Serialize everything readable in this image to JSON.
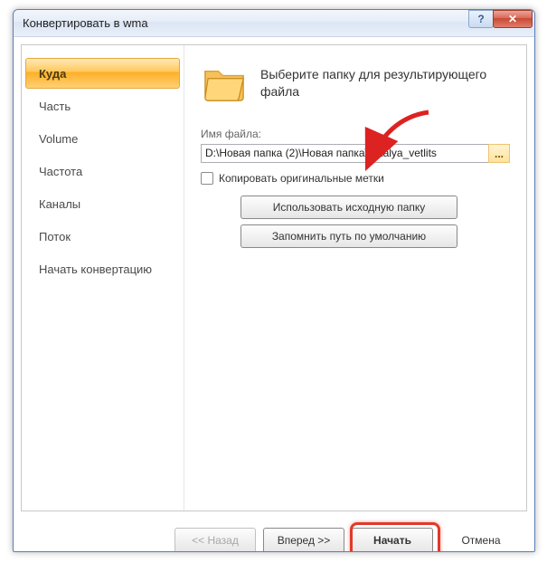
{
  "window": {
    "title": "Конвертировать в wma"
  },
  "sidebar": {
    "items": [
      {
        "label": "Куда"
      },
      {
        "label": "Часть"
      },
      {
        "label": "Volume"
      },
      {
        "label": "Частота"
      },
      {
        "label": "Каналы"
      },
      {
        "label": "Поток"
      },
      {
        "label": "Начать конвертацию"
      }
    ]
  },
  "main": {
    "heading_line1": "Выберите папку для результирующего",
    "heading_line2": "файла",
    "file_label": "Имя файла:",
    "file_path": "D:\\Новая папка (2)\\Новая папка\\natalya_vetlits",
    "browse_label": "...",
    "copy_tags_label": "Копировать оригинальные метки",
    "use_src_folder_label": "Использовать исходную папку",
    "remember_path_label": "Запомнить путь по умолчанию"
  },
  "buttons": {
    "back": "<< Назад",
    "forward": "Вперед >>",
    "start": "Начать",
    "cancel": "Отмена"
  },
  "icons": {
    "help": "?",
    "close": "✕"
  }
}
